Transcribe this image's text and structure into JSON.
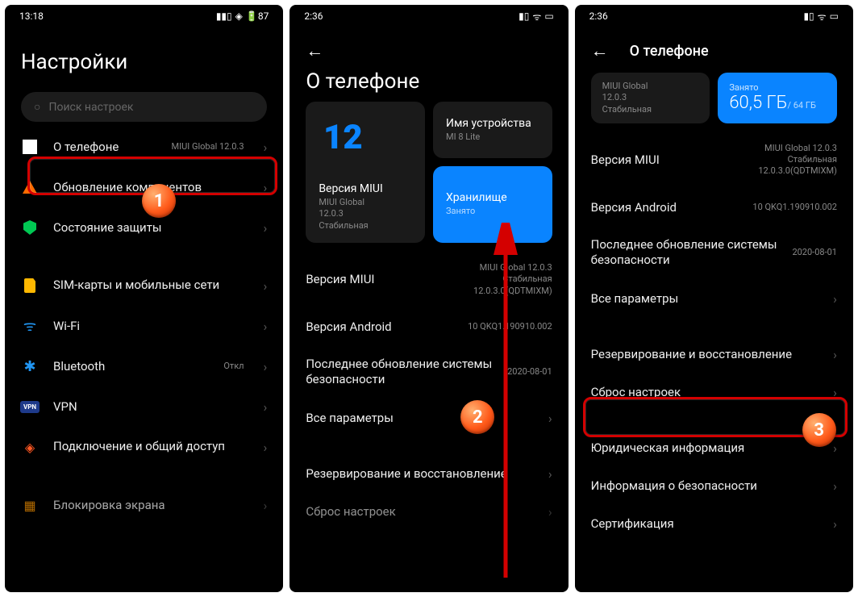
{
  "screen1": {
    "time": "13:18",
    "battery": "87",
    "title": "Настройки",
    "search_placeholder": "Поиск настроек",
    "items": {
      "about": {
        "label": "О телефоне",
        "sub": "MIUI Global 12.0.3"
      },
      "update": {
        "label": "Обновление компонентов"
      },
      "security": {
        "label": "Состояние защиты"
      },
      "sim": {
        "label": "SIM-карты и мобильные сети"
      },
      "wifi": {
        "label": "Wi-Fi",
        "sub": ""
      },
      "bt": {
        "label": "Bluetooth",
        "sub": "Откл"
      },
      "vpn": {
        "label": "VPN"
      },
      "share": {
        "label": "Подключение и общий доступ"
      },
      "lock": {
        "label": "Блокировка экрана"
      }
    }
  },
  "screen2": {
    "time": "2:36",
    "title": "О телефоне",
    "card_miui_title": "Версия MIUI",
    "card_miui_sub": "MIUI Global\n12.0.3\nСтабильная",
    "card_device_title": "Имя устройства",
    "card_device_sub": "MI 8 Lite",
    "card_storage_title": "Хранилище",
    "card_storage_sub": "Занято",
    "rows": {
      "miui": {
        "label": "Версия MIUI",
        "sub": "MIUI Global 12.0.3\nСтабильная\n12.0.3.0(QDTMIXM)"
      },
      "android": {
        "label": "Версия Android",
        "sub": "10 QKQ1.190910.002"
      },
      "security": {
        "label": "Последнее обновление системы безопасности",
        "sub": "2020-08-01"
      },
      "all": {
        "label": "Все параметры"
      },
      "backup": {
        "label": "Резервирование и восстановление"
      },
      "reset": {
        "label": "Сброс настроек"
      }
    }
  },
  "screen3": {
    "time": "2:36",
    "title": "О телефоне",
    "minicard_sub": "MIUI Global\n12.0.3\nСтабильная",
    "storage_label": "Занято",
    "storage_used": "60,5 ГБ",
    "storage_total": "/ 64 ГБ",
    "rows": {
      "miui": {
        "label": "Версия MIUI",
        "sub": "MIUI Global 12.0.3\nСтабильная\n12.0.3.0(QDTMIXM)"
      },
      "android": {
        "label": "Версия Android",
        "sub": "10 QKQ1.190910.002"
      },
      "security": {
        "label": "Последнее обновление системы безопасности",
        "sub": "2020-08-01"
      },
      "all": {
        "label": "Все параметры"
      },
      "backup": {
        "label": "Резервирование и восстановление"
      },
      "reset": {
        "label": "Сброс настроек"
      },
      "legal": {
        "label": "Юридическая информация"
      },
      "secinfo": {
        "label": "Информация о безопасности"
      },
      "cert": {
        "label": "Сертификация"
      }
    }
  },
  "steps": {
    "s1": "1",
    "s2": "2",
    "s3": "3"
  }
}
